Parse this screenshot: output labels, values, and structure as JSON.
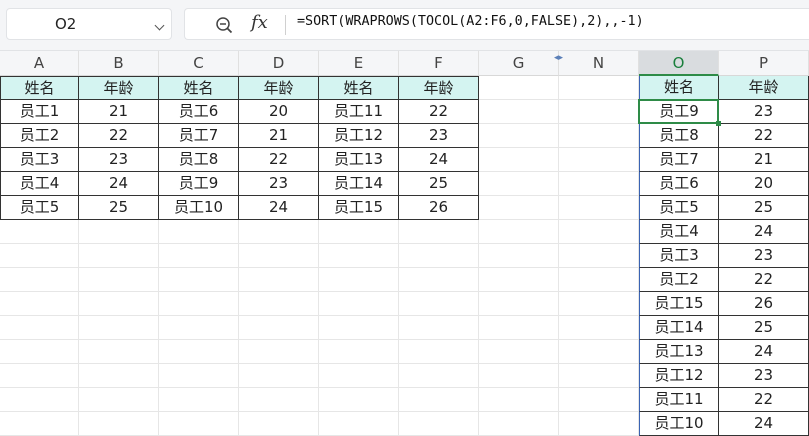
{
  "name_box": {
    "value": "O2"
  },
  "formula_bar": {
    "fx_label": "fx",
    "formula": "=SORT(WRAPROWS(TOCOL(A2:F6,0,FALSE),2),,-1)"
  },
  "grid": {
    "columns": [
      "A",
      "B",
      "C",
      "D",
      "E",
      "F",
      "G",
      "N",
      "O",
      "P"
    ],
    "selected_column": "O",
    "hidden_columns_marker": "◂▸",
    "active_cell": "O2",
    "source_table": [
      [
        "姓名",
        "年龄",
        "姓名",
        "年龄",
        "姓名",
        "年龄"
      ],
      [
        "员工1",
        "21",
        "员工6",
        "20",
        "员工11",
        "22"
      ],
      [
        "员工2",
        "22",
        "员工7",
        "21",
        "员工12",
        "23"
      ],
      [
        "员工3",
        "23",
        "员工8",
        "22",
        "员工13",
        "24"
      ],
      [
        "员工4",
        "24",
        "员工9",
        "23",
        "员工14",
        "25"
      ],
      [
        "员工5",
        "25",
        "员工10",
        "24",
        "员工15",
        "26"
      ]
    ],
    "result_table": [
      [
        "姓名",
        "年龄"
      ],
      [
        "员工9",
        "23"
      ],
      [
        "员工8",
        "22"
      ],
      [
        "员工7",
        "21"
      ],
      [
        "员工6",
        "20"
      ],
      [
        "员工5",
        "25"
      ],
      [
        "员工4",
        "24"
      ],
      [
        "员工3",
        "23"
      ],
      [
        "员工2",
        "22"
      ],
      [
        "员工15",
        "26"
      ],
      [
        "员工14",
        "25"
      ],
      [
        "员工13",
        "24"
      ],
      [
        "员工12",
        "23"
      ],
      [
        "员工11",
        "22"
      ],
      [
        "员工10",
        "24"
      ]
    ]
  },
  "colors": {
    "header_fill": "#d4f4f1",
    "selection_green": "#2e8b47",
    "spill_border": "#3a64b4"
  }
}
